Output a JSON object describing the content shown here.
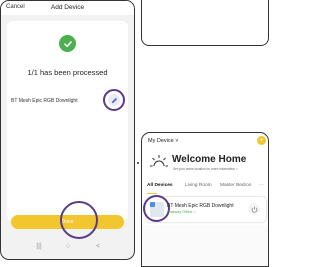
{
  "add_device_screen": {
    "cancel_label": "Cancel",
    "title": "Add Device",
    "status_icon": "check-icon",
    "processed_text": "1/1 has been processed",
    "device_name": "BT Mesh Epic RGB Downlight",
    "edit_icon": "pencil-icon",
    "done_label": "Done",
    "nav": {
      "menu_icon": "|||",
      "home_icon": "○",
      "back_icon": "<"
    },
    "colors": {
      "success": "#4caf50",
      "accent": "#f2c62f",
      "highlight_ring": "#5a3a8c"
    }
  },
  "home_screen": {
    "device_dropdown": "My Device ˅",
    "add_icon": "+",
    "weather_icon": "sun-icon",
    "welcome_title": "Welcome Home",
    "welcome_subtitle": "Set your home location for more information  >",
    "tabs": [
      "All Devices",
      "Living Room",
      "Master Bedroo",
      "···"
    ],
    "device": {
      "name": "BT Mesh Epic RGB Downlight",
      "status": "Gateway Offline  >",
      "power_icon": "power-icon"
    }
  }
}
